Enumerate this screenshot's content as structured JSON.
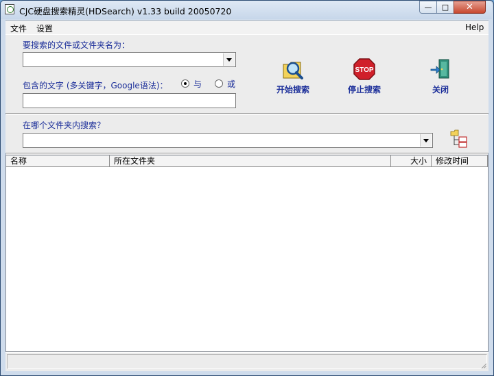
{
  "window": {
    "title": "CJC硬盘搜索精灵(HDSearch) v1.33 build 20050720",
    "min_glyph": "—",
    "max_glyph": "□",
    "close_glyph": "✕"
  },
  "menu": {
    "file": "文件",
    "settings": "设置",
    "help": "Help"
  },
  "search": {
    "filename_label": "要搜索的文件或文件夹名为：",
    "filename_value": "",
    "contains_label": "包含的文字 (多关键字，Google语法)：",
    "contains_value": "",
    "radio_and_label": "与",
    "radio_or_label": "或",
    "radio_selected": "and",
    "folder_label": "在哪个文件夹内搜索？",
    "folder_value": ""
  },
  "toolbar": {
    "start_label": "开始搜索",
    "stop_label": "停止搜索",
    "stop_icon_text": "STOP",
    "close_label": "关闭"
  },
  "results": {
    "columns": [
      "名称",
      "所在文件夹",
      "大小",
      "修改时间"
    ],
    "rows": []
  },
  "status": {
    "text": ""
  },
  "colors": {
    "label_blue": "#1a2d99",
    "stop_red": "#d0202a",
    "title_gradient_top": "#dfe9f5"
  }
}
